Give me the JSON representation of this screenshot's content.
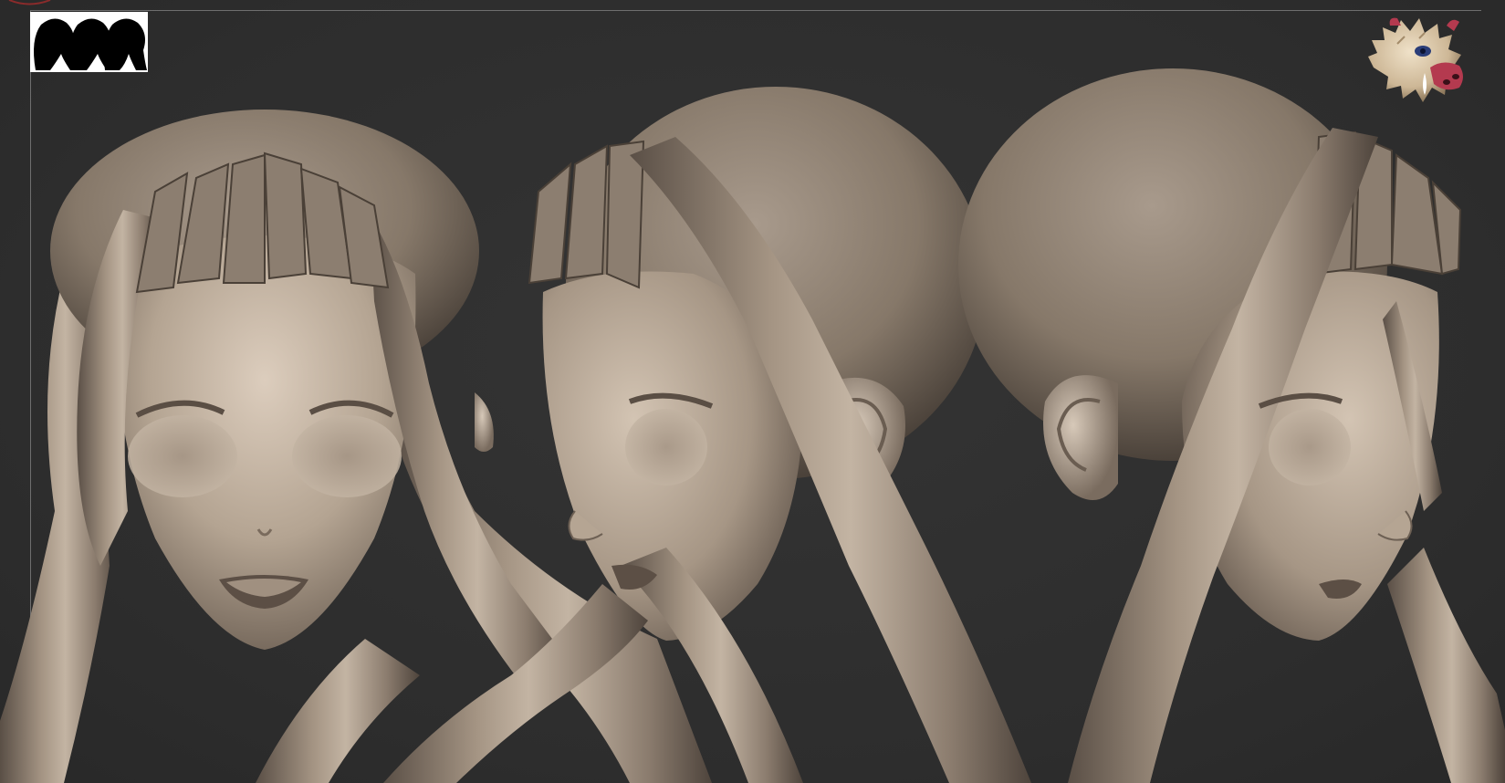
{
  "app": {
    "window_title": "",
    "viewport_label": ""
  },
  "viewport": {
    "background_color": "#2f2f2f",
    "frame_color": "#6e6e6e",
    "clay_color": "#8f8275",
    "clay_highlight": "#cbbdae",
    "clay_shadow": "#4f453d"
  },
  "overlays": {
    "silhouette_thumbnail_icon": "silhouette-heads-icon",
    "material_preview_icon": "boar-mask-material-icon"
  },
  "views": [
    {
      "id": "front",
      "icon": "sculpt-head-front-view"
    },
    {
      "id": "three-quarter-left",
      "icon": "sculpt-head-left-view"
    },
    {
      "id": "three-quarter-right",
      "icon": "sculpt-head-right-view"
    }
  ]
}
